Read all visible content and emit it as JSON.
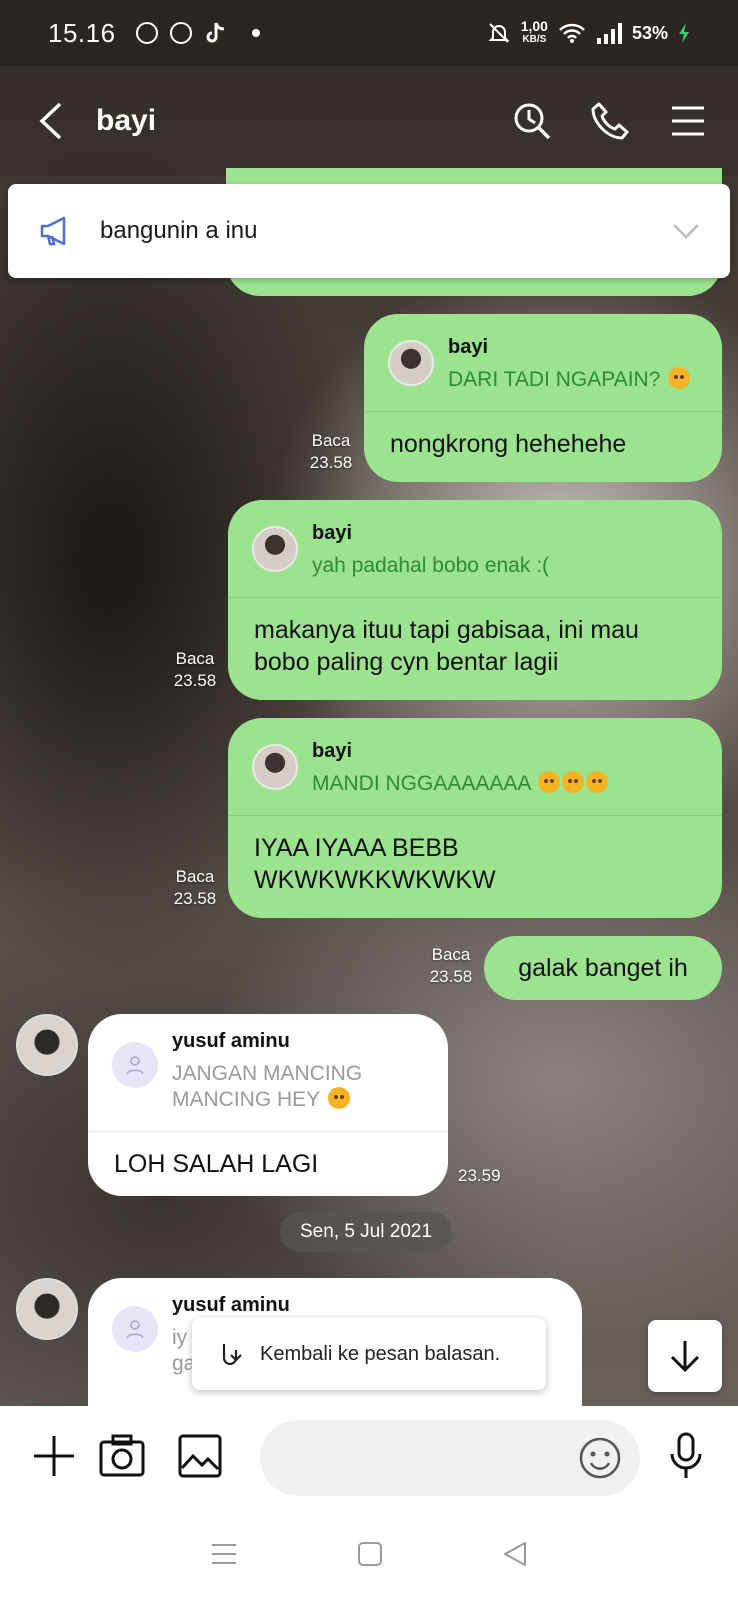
{
  "status_bar": {
    "time": "15.16",
    "net_speed_value": "1,00",
    "net_speed_unit": "KB/S",
    "battery": "53%"
  },
  "header": {
    "title": "bayi",
    "icons": [
      "back-icon",
      "search-clock-icon",
      "phone-icon",
      "menu-icon"
    ]
  },
  "announcement": {
    "text": "bangunin a inu"
  },
  "messages": [
    {
      "direction": "sent",
      "reply_to_name": "bayi",
      "reply_quote": "DARI TADI NGAPAIN?",
      "text": "nongkrong hehehehe",
      "read_label": "Baca",
      "time": "23.58"
    },
    {
      "direction": "sent",
      "reply_to_name": "bayi",
      "reply_quote": "yah padahal bobo enak :(",
      "text_line1": "makanya ituu tapi gabisaa, ini mau",
      "text_line2": "bobo paling cyn bentar lagii",
      "read_label": "Baca",
      "time": "23.58"
    },
    {
      "direction": "sent",
      "reply_to_name": "bayi",
      "reply_quote": "MANDI NGGAAAAAAA",
      "text_line1": "IYAA IYAAA BEBB",
      "text_line2": "WKWKWKKWKWKW",
      "read_label": "Baca",
      "time": "23.58"
    },
    {
      "direction": "sent",
      "text": "galak banget ih",
      "read_label": "Baca",
      "time": "23.58"
    },
    {
      "direction": "received",
      "reply_to_name": "yusuf aminu",
      "reply_quote_line1": "JANGAN MANCING",
      "reply_quote_line2": "MANCING HEY",
      "text": "LOH SALAH LAGI",
      "time": "23.59"
    },
    {
      "direction": "received",
      "reply_to_name": "yusuf aminu",
      "reply_quote_line1": "iy",
      "reply_quote_line2": "ga"
    }
  ],
  "date_separator": "Sen, 5 Jul 2021",
  "toast": {
    "text": "Kembali ke pesan balasan."
  },
  "input": {
    "placeholder": ""
  }
}
